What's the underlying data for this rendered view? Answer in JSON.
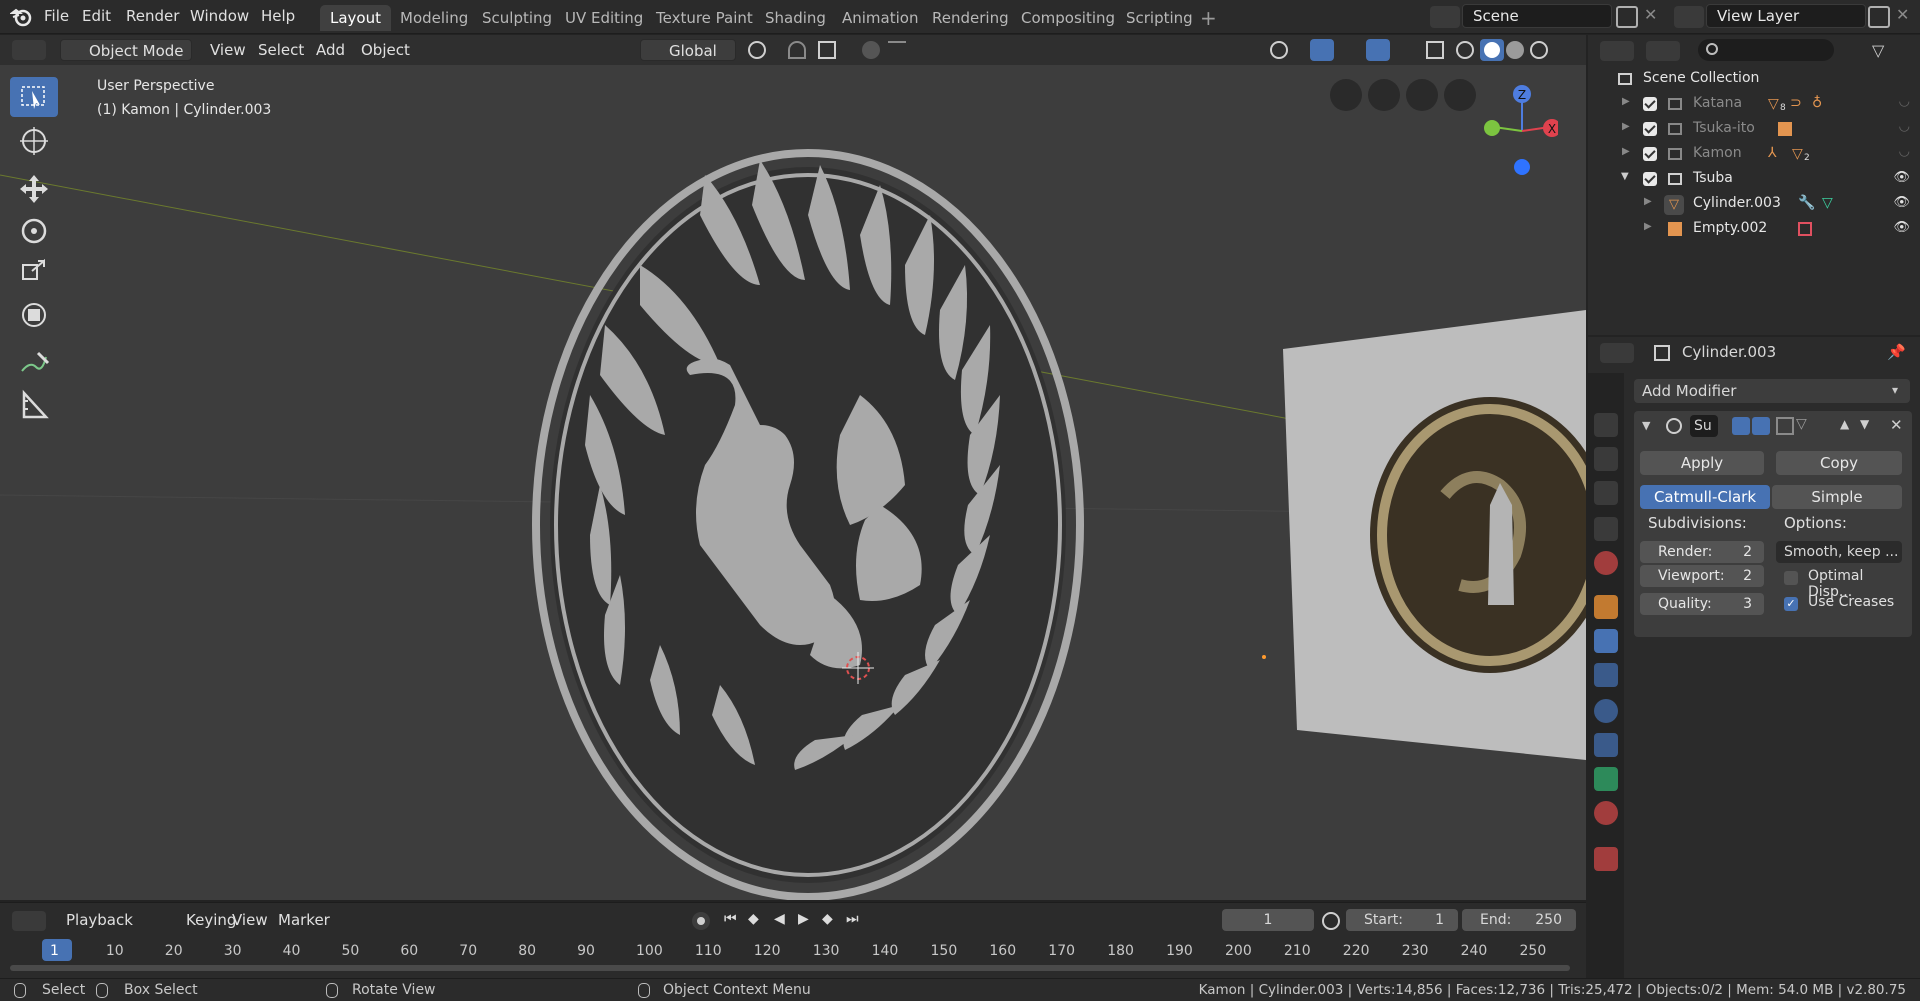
{
  "menu": [
    "File",
    "Edit",
    "Render",
    "Window",
    "Help"
  ],
  "workspaces": [
    "Layout",
    "Modeling",
    "Sculpting",
    "UV Editing",
    "Texture Paint",
    "Shading",
    "Animation",
    "Rendering",
    "Compositing",
    "Scripting"
  ],
  "scene_name": "Scene",
  "view_layer": "View Layer",
  "viewport_header": {
    "mode": "Object Mode",
    "view": "View",
    "select": "Select",
    "add": "Add",
    "object": "Object",
    "orientation": "Global"
  },
  "viewport": {
    "perspective_label": "User Perspective",
    "object_label": "(1) Kamon | Cylinder.003",
    "gizmo_axes": {
      "x": "X",
      "y": "Y",
      "z": "Z"
    }
  },
  "outliner": {
    "search_placeholder": "",
    "scene_collection": "Scene Collection",
    "items": [
      {
        "name": "Katana",
        "count": "8"
      },
      {
        "name": "Tsuka-ito"
      },
      {
        "name": "Kamon",
        "count": "2"
      },
      {
        "name": "Tsuba"
      },
      {
        "name": "Cylinder.003"
      },
      {
        "name": "Empty.002"
      }
    ]
  },
  "properties": {
    "object_name": "Cylinder.003",
    "add_modifier": "Add Modifier",
    "modifier_name": "Su",
    "apply": "Apply",
    "copy": "Copy",
    "catmull": "Catmull-Clark",
    "simple": "Simple",
    "subdivisions_label": "Subdivisions:",
    "options_label": "Options:",
    "render_label": "Render:",
    "render_value": "2",
    "viewport_label": "Viewport:",
    "viewport_value": "2",
    "quality_label": "Quality:",
    "quality_value": "3",
    "uv_smooth": "Smooth, keep ...",
    "optimal_display": "Optimal Disp...",
    "use_creases": "Use Creases"
  },
  "timeline": {
    "playback": "Playback",
    "keying": "Keying",
    "view": "View",
    "marker": "Marker",
    "current_frame": "1",
    "start_label": "Start:",
    "start": "1",
    "end_label": "End:",
    "end": "250",
    "ticks": [
      "1",
      "10",
      "20",
      "30",
      "40",
      "50",
      "60",
      "70",
      "80",
      "90",
      "100",
      "110",
      "120",
      "130",
      "140",
      "150",
      "160",
      "170",
      "180",
      "190",
      "200",
      "210",
      "220",
      "230",
      "240",
      "250"
    ]
  },
  "status": {
    "select": "Select",
    "box_select": "Box Select",
    "rotate_view": "Rotate View",
    "context_menu": "Object Context Menu",
    "stats": "Kamon | Cylinder.003 | Verts:14,856 | Faces:12,736 | Tris:25,472 | Objects:0/2 | Mem: 54.0 MB | v2.80.75"
  }
}
